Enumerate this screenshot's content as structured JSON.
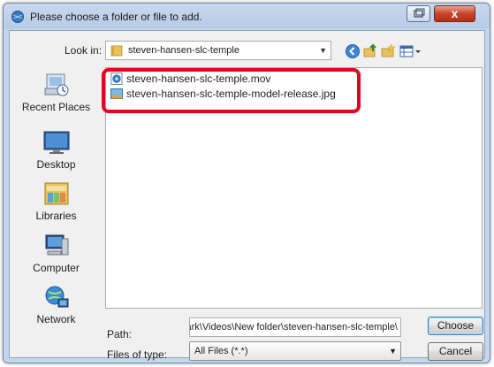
{
  "window": {
    "title": "Please choose a folder or file to add.",
    "close_glyph": "x"
  },
  "lookin": {
    "label": "Look in:",
    "value": "steven-hansen-slc-temple"
  },
  "places": [
    {
      "label": "Recent Places",
      "icon": "recent-places-icon"
    },
    {
      "label": "Desktop",
      "icon": "desktop-icon"
    },
    {
      "label": "Libraries",
      "icon": "libraries-icon"
    },
    {
      "label": "Computer",
      "icon": "computer-icon"
    },
    {
      "label": "Network",
      "icon": "network-icon"
    }
  ],
  "files": [
    {
      "name": "steven-hansen-slc-temple.mov",
      "icon": "mov-file-icon"
    },
    {
      "name": "steven-hansen-slc-temple-model-release.jpg",
      "icon": "jpg-file-icon"
    }
  ],
  "path": {
    "label": "Path:",
    "value": "C:\\Users\\Clark\\Videos\\New folder\\steven-hansen-slc-temple\\"
  },
  "filetypes": {
    "label": "Files of type:",
    "value": "All Files (*.*)"
  },
  "buttons": {
    "choose": "Choose",
    "cancel": "Cancel"
  },
  "colors": {
    "highlight": "#e8001c",
    "title_bar": "#b6cbe6"
  }
}
